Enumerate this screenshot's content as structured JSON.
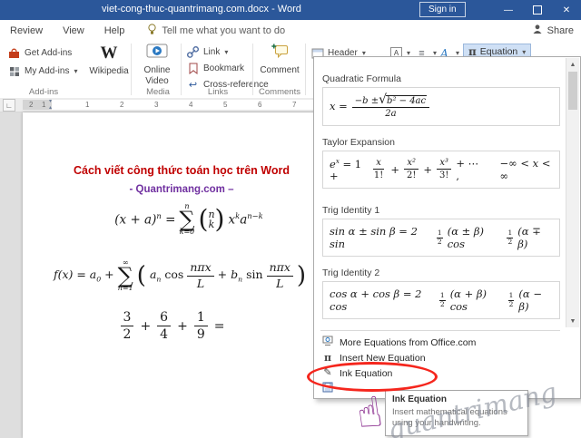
{
  "titlebar": {
    "title": "viet-cong-thuc-quantrimang.com.docx - Word",
    "sign_in": "Sign in"
  },
  "ribbon": {
    "tabs": [
      {
        "label": "Review"
      },
      {
        "label": "View"
      },
      {
        "label": "Help"
      }
    ],
    "tell_me": "Tell me what you want to do",
    "share": "Share",
    "addins": {
      "get": "Get Add-ins",
      "my": "My Add-ins",
      "wikipedia": "Wikipedia",
      "group": "Add-ins"
    },
    "media": {
      "online_video": "Online Video",
      "group": "Media"
    },
    "links": {
      "link": "Link",
      "bookmark": "Bookmark",
      "crossref": "Cross-reference",
      "group": "Links"
    },
    "comments": {
      "comment": "Comment",
      "group": "Comments"
    },
    "header_footer": {
      "header": "Header"
    },
    "symbols": {
      "equation": "Equation"
    }
  },
  "ruler": {
    "left_numbers": [
      "2",
      "1"
    ],
    "numbers": [
      "1",
      "2",
      "3",
      "4",
      "5",
      "6",
      "7"
    ]
  },
  "doc": {
    "heading": "Cách viết công thức toán học trên Word",
    "subheading": "- Quantrimang.com –",
    "eq1": {
      "lhs": "(x + a)",
      "lhs_sup": "n",
      "equals": "=",
      "sum_top": "n",
      "sum_op": "∑",
      "sum_bot": "k=0",
      "paren_open": "(",
      "binom_top": "n",
      "binom_bot": "k",
      "paren_close": ")",
      "x": "x",
      "x_sup": "k",
      "a": "a",
      "a_sup": "n−k"
    },
    "eq2": {
      "lhs": "f(x) = a",
      "lhs_sub": "0",
      "plus": "+",
      "sum_top": "∞",
      "sum_op": "∑",
      "sum_bot": "n=1",
      "paren_open": "(",
      "a_n": "a",
      "a_n_sub": "n",
      "cos": "cos",
      "frac1_num": "nπx",
      "frac1_den": "L",
      "mid": "+ b",
      "b_sub": "n",
      "sin": "sin",
      "frac2_num": "nπx",
      "frac2_den": "L",
      "paren_close": ")"
    },
    "eq3": {
      "f1_num": "3",
      "f1_den": "2",
      "op1": "+",
      "f2_num": "6",
      "f2_den": "4",
      "op2": "+",
      "f3_num": "1",
      "f3_den": "9",
      "equals": "="
    }
  },
  "equation_menu": {
    "quadratic": {
      "title": "Quadratic Formula",
      "lhs": "x =",
      "num_pre": "−b ± ",
      "radical": "√",
      "sqrt_arg": "b² − 4ac",
      "den": "2a"
    },
    "taylor": {
      "title": "Taylor Expansion",
      "e": "e",
      "e_sup": "x",
      "eq": "= 1 +",
      "f1_num": "x",
      "f1_den": "1!",
      "p1": "+",
      "f2_num": "x²",
      "f2_den": "2!",
      "p2": "+",
      "f3_num": "x³",
      "f3_den": "3!",
      "tail": "+ ⋯ ,",
      "range": "−∞ < x < ∞"
    },
    "trig1": {
      "title": "Trig Identity 1",
      "lhs": "sin α ± sin β = 2 sin",
      "h1_num": "1",
      "h1_den": "2",
      "mid": "(α ± β) cos",
      "h2_num": "1",
      "h2_den": "2",
      "tail": "(α ∓ β)"
    },
    "trig2": {
      "title": "Trig Identity 2",
      "lhs": "cos α + cos β = 2 cos",
      "h1_num": "1",
      "h1_den": "2",
      "mid": "(α + β) cos",
      "h2_num": "1",
      "h2_den": "2",
      "tail": "(α − β)"
    },
    "more_equations": "More Equations from Office.com",
    "insert_new": "Insert New Equation",
    "ink_equation": "Ink Equation"
  },
  "tooltip": {
    "title": "Ink Equation",
    "body": "Insert mathematical equations using your handwriting."
  },
  "watermark": "quantrimang",
  "icons": {
    "pi": "π",
    "wikipedia_w": "W",
    "pen": "✎",
    "dropdown_arrow": "▾",
    "scroll_up": "▲",
    "scroll_down": "▼",
    "hand": "☝",
    "close": "✕",
    "minimize": "—",
    "crossref_arrow": "↩",
    "quickparts": "≡",
    "wordart_a": "A",
    "textbox_a": "A",
    "tab_selector": "∟",
    "indent_down": "▾",
    "indent_up": "▴"
  }
}
